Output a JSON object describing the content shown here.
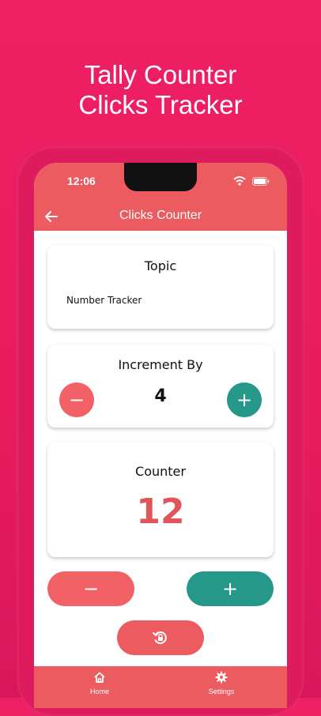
{
  "promo": {
    "title_line1": "Tally Counter",
    "title_line2": "Clicks Tracker"
  },
  "status_bar": {
    "time": "12:06",
    "icons": [
      "wifi-icon",
      "battery-icon"
    ]
  },
  "app_bar": {
    "title": "Clicks Counter",
    "back_icon": "arrow-left-icon"
  },
  "topic_card": {
    "title": "Topic",
    "value": "Number Tracker"
  },
  "increment_card": {
    "title": "Increment By",
    "value": "4",
    "minus_label": "−",
    "plus_label": "+"
  },
  "counter_card": {
    "title": "Counter",
    "value": "12"
  },
  "actions": {
    "decrement_label": "−",
    "increment_label": "+",
    "reset_icon": "reset-lock-icon"
  },
  "bottom_nav": {
    "items": [
      {
        "label": "Home",
        "icon": "home-icon"
      },
      {
        "label": "Settings",
        "icon": "gear-icon"
      }
    ]
  },
  "colors": {
    "background": "#e81c5f",
    "app_bar": "#ec5b60",
    "coral": "#f26166",
    "teal": "#26988a",
    "counter_text": "#e0555a"
  }
}
